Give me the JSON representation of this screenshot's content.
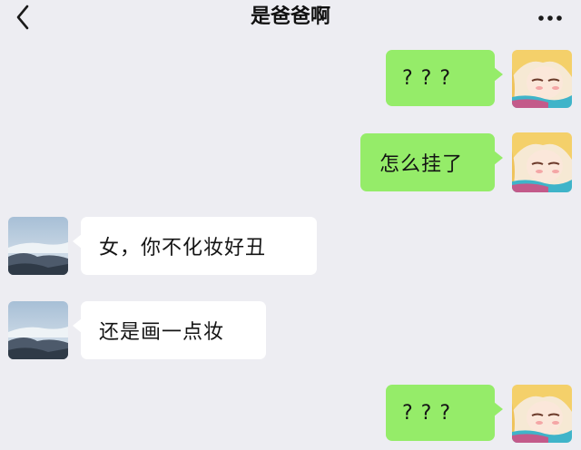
{
  "header": {
    "title": "是爸爸啊",
    "back_icon": "chevron-left-icon",
    "more_icon": "ellipsis-icon"
  },
  "messages": [
    {
      "from": "me",
      "text": "? ? ?"
    },
    {
      "from": "me",
      "text": "怎么挂了"
    },
    {
      "from": "other",
      "text": "女，你不化妆好丑"
    },
    {
      "from": "other",
      "text": "还是画一点妆"
    },
    {
      "from": "me",
      "text": "? ? ?"
    }
  ],
  "colors": {
    "background": "#ededf2",
    "sent_bubble": "#95ec69",
    "received_bubble": "#ffffff"
  }
}
